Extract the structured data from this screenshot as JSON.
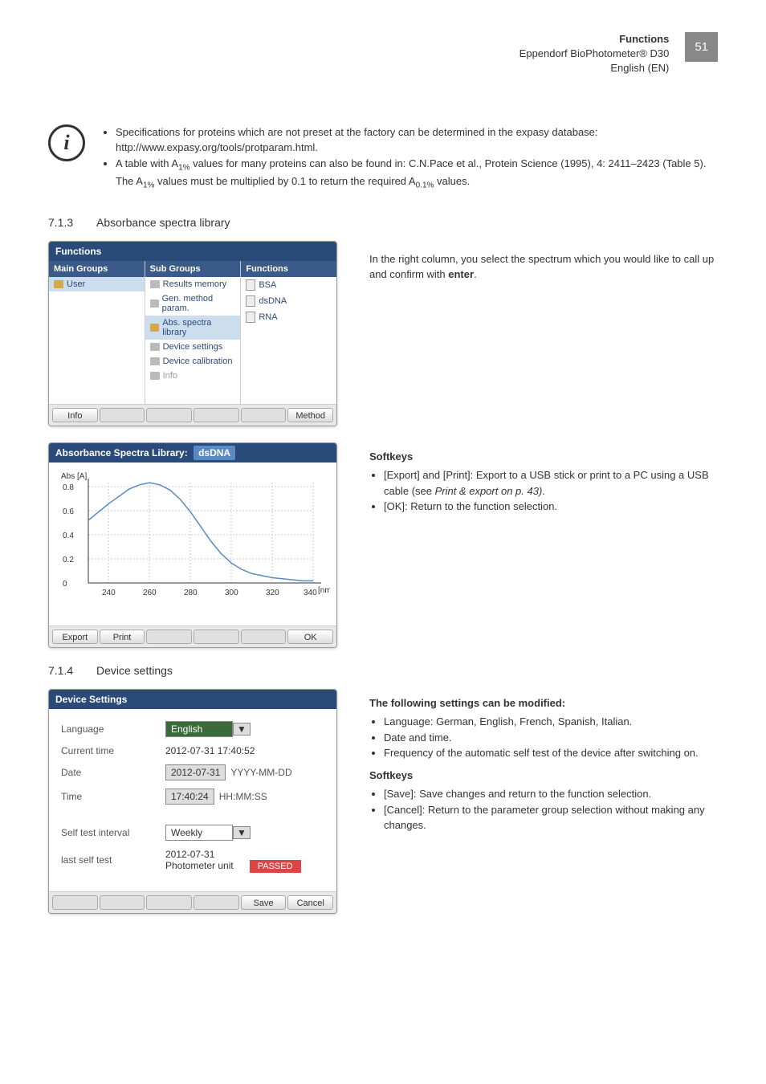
{
  "header": {
    "line1": "Functions",
    "line2": "Eppendorf BioPhotometer® D30",
    "line3": "English (EN)",
    "pagenum": "51"
  },
  "info": {
    "b1": "Specifications for proteins which are not preset at the factory can be determined in the expasy database: http://www.expasy.org/tools/protparam.html.",
    "b2a": "A table with A",
    "b2b": " values for many proteins can also be found in: C.N.Pace et al., Protein Science (1995), 4: 2411–2423 (Table 5). The A",
    "b2c": " values must be multiplied by 0.1 to return the required A",
    "b2d": " values.",
    "sub": "1%",
    "sub2": "0.1%"
  },
  "sec713": {
    "num": "7.1.3",
    "title": "Absorbance spectra library"
  },
  "scr1": {
    "title": "Functions",
    "col1": {
      "hdr": "Main Groups",
      "items": [
        {
          "t": "User",
          "sel": true
        }
      ]
    },
    "col2": {
      "hdr": "Sub Groups",
      "items": [
        {
          "t": "Results memory"
        },
        {
          "t": "Gen. method param."
        },
        {
          "t": "Abs. spectra library",
          "sel": true
        },
        {
          "t": "Device settings"
        },
        {
          "t": "Device calibration"
        },
        {
          "t": "Info",
          "dim": true
        }
      ]
    },
    "col3": {
      "hdr": "Functions",
      "items": [
        {
          "t": "BSA",
          "doc": true
        },
        {
          "t": "dsDNA",
          "doc": true
        },
        {
          "t": "RNA",
          "doc": true
        }
      ]
    },
    "btns": [
      "Info",
      "",
      "",
      "",
      "",
      "Method"
    ]
  },
  "scr1_desc": {
    "p": "In the right column, you select the spectrum which you would like to call up and confirm with ",
    "bold": "enter",
    "end": "."
  },
  "scr2": {
    "title": "Absorbance Spectra Library:",
    "tag": "dsDNA",
    "ylabel": "Abs [A]",
    "xlabel_suffix": "[nm]",
    "btns": [
      "Export",
      "Print",
      "",
      "",
      "",
      "OK"
    ]
  },
  "scr2_desc": {
    "sk": "Softkeys",
    "b1": "[Export] and [Print]: Export to a USB stick or print to a PC using a USB cable (see ",
    "i1": "Print & export on p. 43)",
    "b1e": ".",
    "b2": "[OK]: Return to the function selection."
  },
  "sec714": {
    "num": "7.1.4",
    "title": "Device settings"
  },
  "scr3": {
    "title": "Device Settings",
    "rows": {
      "lang": {
        "lbl": "Language",
        "val": "English"
      },
      "ctime": {
        "lbl": "Current time",
        "val": "2012-07-31 17:40:52"
      },
      "date": {
        "lbl": "Date",
        "val": "2012-07-31",
        "hint": "YYYY-MM-DD"
      },
      "time": {
        "lbl": "Time",
        "val": "17:40:24",
        "hint": "HH:MM:SS"
      },
      "sti": {
        "lbl": "Self test interval",
        "val": "Weekly"
      },
      "lst": {
        "lbl": "last self test",
        "v1": "2012-07-31",
        "v2": "Photometer unit",
        "badge": "PASSED"
      }
    },
    "btns": [
      "",
      "",
      "",
      "",
      "Save",
      "Cancel"
    ]
  },
  "scr3_desc": {
    "h": "The following settings can be modified:",
    "b1": "Language: German, English, French, Spanish, Italian.",
    "b2": "Date and time.",
    "b3": "Frequency of the automatic self test of the device after switching on.",
    "sk": "Softkeys",
    "s1": "[Save]: Save changes and return to the function selection.",
    "s2": "[Cancel]: Return to the parameter group selection without making any changes."
  },
  "chart_data": {
    "type": "line",
    "title": "Absorbance Spectra Library: dsDNA",
    "xlabel": "[nm]",
    "ylabel": "Abs [A]",
    "x": [
      230,
      235,
      240,
      245,
      250,
      255,
      260,
      265,
      270,
      275,
      280,
      285,
      290,
      295,
      300,
      305,
      310,
      315,
      320,
      325,
      330,
      335,
      340
    ],
    "y": [
      0.6,
      0.68,
      0.76,
      0.83,
      0.9,
      0.94,
      0.96,
      0.94,
      0.89,
      0.8,
      0.68,
      0.54,
      0.4,
      0.28,
      0.19,
      0.13,
      0.09,
      0.07,
      0.05,
      0.04,
      0.03,
      0.02,
      0.02
    ],
    "xticks": [
      240,
      260,
      280,
      300,
      320,
      340
    ],
    "yticks": [
      0.0,
      0.2,
      0.4,
      0.6,
      0.8
    ],
    "xlim": [
      230,
      340
    ],
    "ylim": [
      0,
      1.0
    ]
  }
}
